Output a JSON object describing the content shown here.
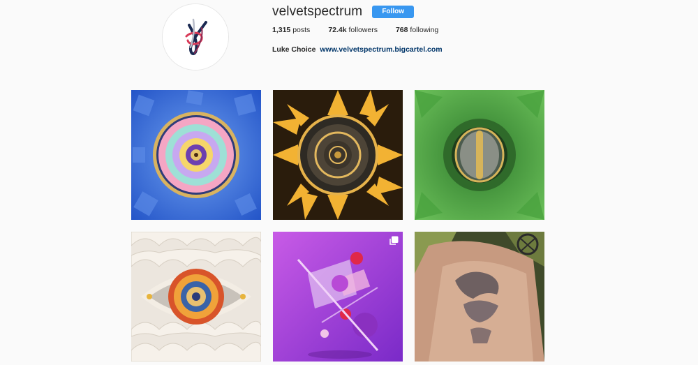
{
  "profile": {
    "username": "velvetspectrum",
    "follow_label": "Follow",
    "stats": {
      "posts_count": "1,315",
      "posts_label": "posts",
      "followers_count": "72.4k",
      "followers_label": "followers",
      "following_count": "768",
      "following_label": "following"
    },
    "bio": {
      "full_name": "Luke Choice",
      "website": "www.velvetspectrum.bigcartel.com"
    },
    "avatar_icon": "velvet-spectrum-logo"
  },
  "posts": [
    {
      "description_icon": "blue-mandala-image",
      "accent": "#3a6fd8"
    },
    {
      "description_icon": "gold-mandala-image",
      "accent": "#e5a72a"
    },
    {
      "description_icon": "green-eye-image",
      "accent": "#3fa33c"
    },
    {
      "description_icon": "white-eye-image",
      "accent": "#d8542a"
    },
    {
      "description_icon": "purple-shapes-image",
      "accent": "#9b3fd6",
      "multi_icon": "multiple-images-icon"
    },
    {
      "description_icon": "tattoo-photo-image",
      "accent": "#6f7a4d"
    }
  ],
  "colors": {
    "follow_button": "#3897f0",
    "link": "#003569",
    "background": "#fafafa"
  }
}
